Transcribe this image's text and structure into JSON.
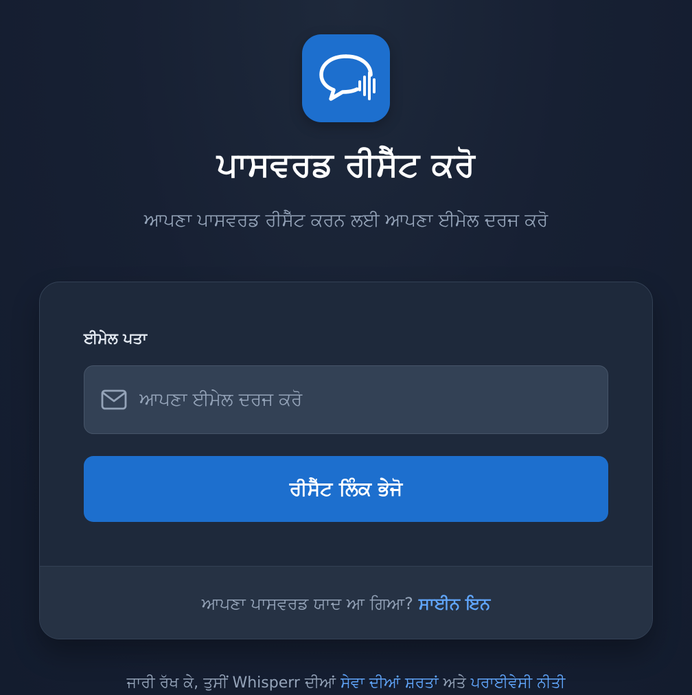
{
  "app": {
    "logo_icon": "chat-bubble-soundwave-icon",
    "accent_color": "#1d6fce"
  },
  "header": {
    "title": "ਪਾਸਵਰਡ ਰੀਸੈੱਟ ਕਰੋ",
    "subtitle": "ਆਪਣਾ ਪਾਸਵਰਡ ਰੀਸੈੱਟ ਕਰਨ ਲਈ ਆਪਣਾ ਈਮੇਲ ਦਰਜ ਕਰੋ"
  },
  "form": {
    "email_label": "ਈਮੇਲ ਪਤਾ",
    "email_placeholder": "ਆਪਣਾ ਈਮੇਲ ਦਰਜ ਕਰੋ",
    "email_icon": "mail-icon",
    "submit_label": "ਰੀਸੈੱਟ ਲਿੰਕ ਭੇਜੋ"
  },
  "footer": {
    "remember_text": "ਆਪਣਾ ਪਾਸਵਰਡ ਯਾਦ ਆ ਗਿਆ?",
    "signin_label": "ਸਾਈਨ ਇਨ"
  },
  "terms": {
    "prefix": "ਜਾਰੀ ਰੱਖ ਕੇ, ਤੁਸੀਂ Whisperr ਦੀਆਂ",
    "tos_label": "ਸੇਵਾ ਦੀਆਂ ਸ਼ਰਤਾਂ",
    "and": "ਅਤੇ",
    "privacy_label": "ਪਰਾਈਵੇਸੀ ਨੀਤੀ"
  }
}
